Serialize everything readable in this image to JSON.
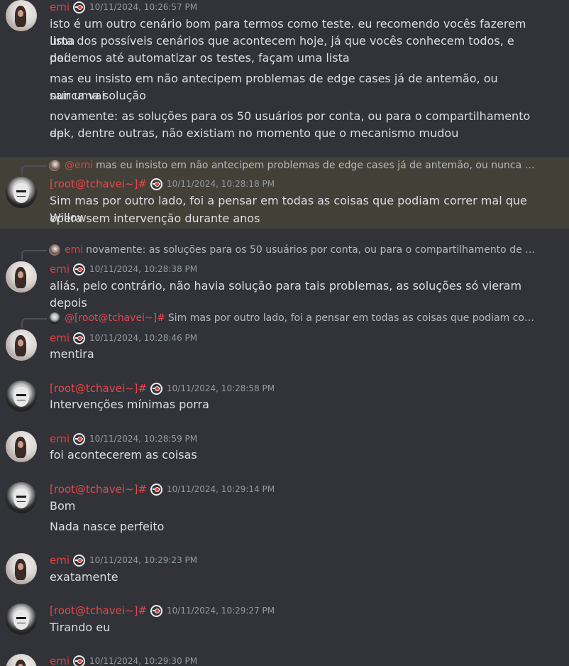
{
  "messages": [
    {
      "author": "emi",
      "timestamp": "10/11/2024, 10:26:57 PM",
      "lines": [
        "isto é um outro cenário bom para termos como teste. eu recomendo vocês fazerem uma",
        "lista dos possíveis cenários que acontecem hoje, já que vocês conhecem todos, e daí",
        "podemos até automatizar os testes, façam uma lista",
        "mas eu insisto em não antecipem problemas de edge cases já de antemão, ou nunca vai",
        "sair uma solução",
        "novamente: as soluções para os 50 usuários por conta, ou para o compartilhamento de",
        "apk, dentre outras, não existiam no momento que o mecanismo mudou"
      ]
    },
    {
      "author": "[root@tchavei~]#",
      "timestamp": "10/11/2024, 10:28:18 PM",
      "reply_name": "@emi",
      "reply_text": "mas eu insisto em não antecipem problemas de edge cases já de antemão, ou nunca vai sair u...",
      "lines": [
        "Sim mas por outro lado, foi a pensar em todas as coisas que podiam correr mal que Willow",
        "opera sem intervenção durante anos"
      ]
    },
    {
      "author": "emi",
      "timestamp": "10/11/2024, 10:28:38 PM",
      "reply_name": "emi",
      "reply_text": "novamente: as soluções para os 50 usuários por conta, ou para o compartilhamento de apk, de...",
      "lines": [
        "aliás, pelo contrário, não havia solução para tais problemas, as soluções só vieram depois"
      ]
    },
    {
      "author": "emi",
      "timestamp": "10/11/2024, 10:28:46 PM",
      "reply_name": "@[root@tchavei~]#",
      "reply_text": "Sim mas por outro lado, foi a pensar em todas as coisas que podiam correr mal...",
      "lines": [
        "mentira"
      ]
    },
    {
      "author": "[root@tchavei~]#",
      "timestamp": "10/11/2024, 10:28:58 PM",
      "lines": [
        "Intervenções mínimas porra"
      ]
    },
    {
      "author": "emi",
      "timestamp": "10/11/2024, 10:28:59 PM",
      "lines": [
        "foi acontecerem as coisas"
      ]
    },
    {
      "author": "[root@tchavei~]#",
      "timestamp": "10/11/2024, 10:29:14 PM",
      "lines": [
        "Bom",
        "Nada nasce perfeito"
      ]
    },
    {
      "author": "emi",
      "timestamp": "10/11/2024, 10:29:23 PM",
      "lines": [
        "exatamente"
      ]
    },
    {
      "author": "[root@tchavei~]#",
      "timestamp": "10/11/2024, 10:29:27 PM",
      "lines": [
        "Tirando eu"
      ]
    },
    {
      "author": "emi",
      "timestamp": "10/11/2024, 10:29:30 PM",
      "lines": []
    }
  ],
  "colors": {
    "background": "#313338",
    "highlight": "#434038",
    "author_red": "#e63e3e",
    "text": "#dbdee1",
    "timestamp": "#949ba4"
  },
  "icons": {
    "role_badge": "pokeball-badge-icon"
  }
}
